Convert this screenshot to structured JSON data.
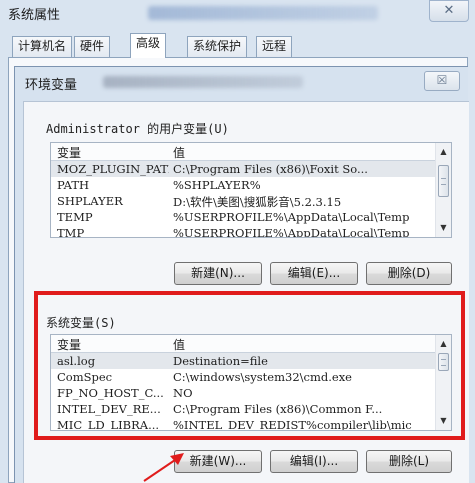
{
  "window": {
    "title": "系统属性",
    "close_glyph": "✕"
  },
  "tabs": [
    {
      "label": "计算机名"
    },
    {
      "label": "硬件"
    },
    {
      "label": "高级"
    },
    {
      "label": "系统保护"
    },
    {
      "label": "远程"
    }
  ],
  "env_dialog": {
    "title": "环境变量",
    "close_glyph": "☒",
    "user_vars": {
      "label": "Administrator 的用户变量(U)",
      "col_variable": "变量",
      "col_value": "值",
      "rows": [
        {
          "name": "MOZ_PLUGIN_PATH",
          "value": "C:\\Program Files (x86)\\Foxit So..."
        },
        {
          "name": "PATH",
          "value": "%SHPLAYER%"
        },
        {
          "name": "SHPLAYER",
          "value": "D:\\软件\\美图\\搜狐影音\\5.2.3.15"
        },
        {
          "name": "TEMP",
          "value": "%USERPROFILE%\\AppData\\Local\\Temp"
        },
        {
          "name": "TMP",
          "value": "%USERPROFILE%\\AppData\\Local\\Temp"
        }
      ],
      "buttons": {
        "new": "新建(N)...",
        "edit": "编辑(E)...",
        "delete": "删除(D)"
      }
    },
    "system_vars": {
      "label": "系统变量(S)",
      "col_variable": "变量",
      "col_value": "值",
      "rows": [
        {
          "name": "asl.log",
          "value": "Destination=file"
        },
        {
          "name": "ComSpec",
          "value": "C:\\windows\\system32\\cmd.exe"
        },
        {
          "name": "FP_NO_HOST_C...",
          "value": "NO"
        },
        {
          "name": "INTEL_DEV_RE...",
          "value": "C:\\Program Files (x86)\\Common F..."
        },
        {
          "name": "MIC_LD_LIBRA...",
          "value": "%INTEL_DEV_REDIST%compiler\\lib\\mic"
        }
      ],
      "buttons": {
        "new": "新建(W)...",
        "edit": "编辑(I)...",
        "delete": "删除(L)"
      }
    }
  },
  "colors": {
    "highlight": "#e01c1c",
    "selected_row": "#e3e7ec"
  },
  "icons": {
    "scroll_up": "▲",
    "scroll_down": "▼"
  }
}
